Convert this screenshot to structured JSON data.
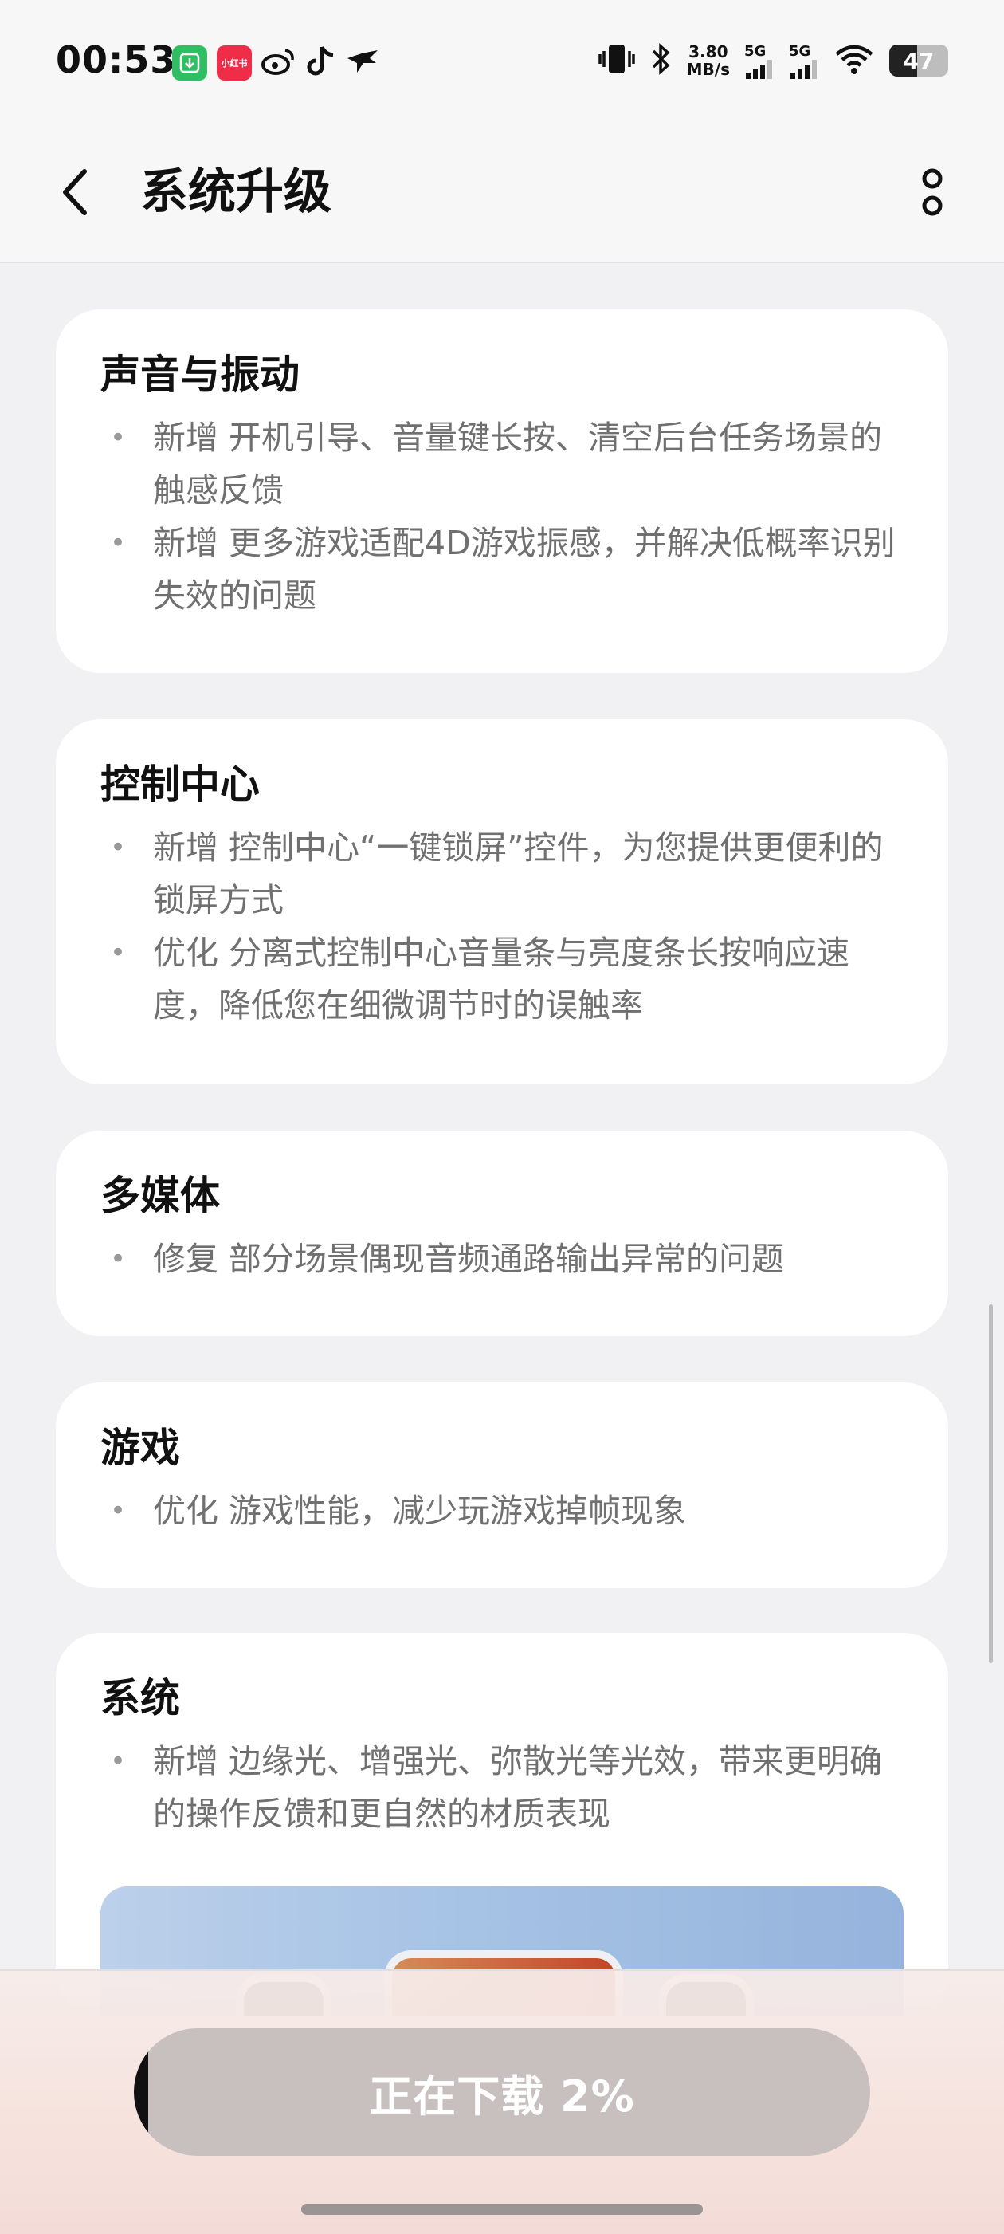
{
  "status_bar": {
    "time": "00:53",
    "left_icons": [
      "download-app-icon",
      "xiaohongshu-app-icon",
      "weibo-icon",
      "tiktok-icon",
      "bird-app-icon"
    ],
    "xiaohongshu_label": "小红书",
    "network_speed_value": "3.80",
    "network_speed_unit": "MB/s",
    "sim1_label": "5G",
    "sim2_label": "5G",
    "battery_level": "47",
    "battery_percent": 47
  },
  "header": {
    "title": "系统升级"
  },
  "sections": [
    {
      "title": "声音与振动",
      "items": [
        "新增 开机引导、音量键长按、清空后台任务场景的触感反馈",
        "新增 更多游戏适配4D游戏振感，并解决低概率识别失效的问题"
      ]
    },
    {
      "title": "控制中心",
      "items": [
        "新增 控制中心“一键锁屏”控件，为您提供更便利的锁屏方式",
        "优化 分离式控制中心音量条与亮度条长按响应速度，降低您在细微调节时的误触率"
      ]
    },
    {
      "title": "多媒体",
      "items": [
        "修复 部分场景偶现音频通路输出异常的问题"
      ]
    },
    {
      "title": "游戏",
      "items": [
        "优化 游戏性能，减少玩游戏掉帧现象"
      ]
    },
    {
      "title": "系统",
      "items": [
        "新增 边缘光、增强光、弥散光等光效，带来更明确的操作反馈和更自然的材质表现"
      ]
    }
  ],
  "download": {
    "label": "正在下载 2%",
    "progress_percent": 2
  }
}
